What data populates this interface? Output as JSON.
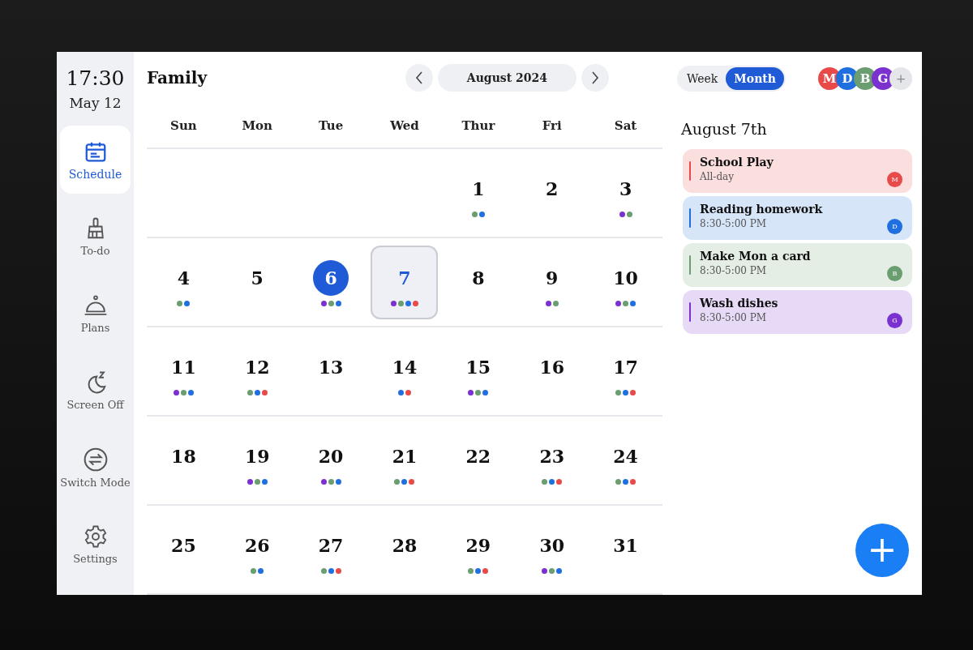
{
  "clock": {
    "time": "17:30",
    "date": "May 12"
  },
  "sidebar": {
    "items": [
      {
        "label": "Schedule",
        "selected": true
      },
      {
        "label": "To-do",
        "selected": false
      },
      {
        "label": "Plans",
        "selected": false
      },
      {
        "label": "Screen Off",
        "selected": false
      },
      {
        "label": "Switch Mode",
        "selected": false
      },
      {
        "label": "Settings",
        "selected": false
      }
    ]
  },
  "header": {
    "title": "Family",
    "month": "August 2024"
  },
  "view_toggle": [
    {
      "label": "Week",
      "selected": false
    },
    {
      "label": "Month",
      "selected": true
    }
  ],
  "members": [
    {
      "initial": "M",
      "color": "#e84a4a"
    },
    {
      "initial": "D",
      "color": "#1f6fe0"
    },
    {
      "initial": "B",
      "color": "#6a9e70"
    },
    {
      "initial": "G",
      "color": "#7b30d0"
    }
  ],
  "add_member": "+",
  "weekdays": [
    "Sun",
    "Mon",
    "Tue",
    "Wed",
    "Thur",
    "Fri",
    "Sat"
  ],
  "days": [
    {
      "kind": "blank"
    },
    {
      "kind": "blank"
    },
    {
      "kind": "blank"
    },
    {
      "kind": "blank"
    },
    {
      "kind": "day",
      "label": "1",
      "today": false,
      "selected": false,
      "dots": [
        {
          "color": "#6a9e70"
        },
        {
          "color": "#1f6fe0"
        }
      ]
    },
    {
      "kind": "day",
      "label": "2",
      "today": false,
      "selected": false
    },
    {
      "kind": "day",
      "label": "3",
      "today": false,
      "selected": false,
      "dots": [
        {
          "color": "#7b30d0"
        },
        {
          "color": "#6a9e70"
        }
      ]
    },
    {
      "kind": "day",
      "label": "4",
      "today": false,
      "selected": false,
      "dots": [
        {
          "color": "#6a9e70"
        },
        {
          "color": "#1f6fe0"
        }
      ]
    },
    {
      "kind": "day",
      "label": "5",
      "today": false,
      "selected": false
    },
    {
      "kind": "day",
      "label": "6",
      "today": true,
      "selected": false,
      "dots": [
        {
          "color": "#7b30d0"
        },
        {
          "color": "#6a9e70"
        },
        {
          "color": "#1f6fe0"
        }
      ]
    },
    {
      "kind": "day",
      "label": "7",
      "today": false,
      "selected": true,
      "dots": [
        {
          "color": "#7b30d0"
        },
        {
          "color": "#6a9e70"
        },
        {
          "color": "#1f6fe0"
        },
        {
          "color": "#e84a4a"
        }
      ]
    },
    {
      "kind": "day",
      "label": "8",
      "today": false,
      "selected": false
    },
    {
      "kind": "day",
      "label": "9",
      "today": false,
      "selected": false,
      "dots": [
        {
          "color": "#7b30d0"
        },
        {
          "color": "#6a9e70"
        }
      ]
    },
    {
      "kind": "day",
      "label": "10",
      "today": false,
      "selected": false,
      "dots": [
        {
          "color": "#7b30d0"
        },
        {
          "color": "#6a9e70"
        },
        {
          "color": "#1f6fe0"
        }
      ]
    },
    {
      "kind": "day",
      "label": "11",
      "today": false,
      "selected": false,
      "dots": [
        {
          "color": "#7b30d0"
        },
        {
          "color": "#6a9e70"
        },
        {
          "color": "#1f6fe0"
        }
      ]
    },
    {
      "kind": "day",
      "label": "12",
      "today": false,
      "selected": false,
      "dots": [
        {
          "color": "#6a9e70"
        },
        {
          "color": "#1f6fe0"
        },
        {
          "color": "#e84a4a"
        }
      ]
    },
    {
      "kind": "day",
      "label": "13",
      "today": false,
      "selected": false
    },
    {
      "kind": "day",
      "label": "14",
      "today": false,
      "selected": false,
      "dots": [
        {
          "color": "#1f6fe0"
        },
        {
          "color": "#e84a4a"
        }
      ]
    },
    {
      "kind": "day",
      "label": "15",
      "today": false,
      "selected": false,
      "dots": [
        {
          "color": "#7b30d0"
        },
        {
          "color": "#6a9e70"
        },
        {
          "color": "#1f6fe0"
        }
      ]
    },
    {
      "kind": "day",
      "label": "16",
      "today": false,
      "selected": false
    },
    {
      "kind": "day",
      "label": "17",
      "today": false,
      "selected": false,
      "dots": [
        {
          "color": "#6a9e70"
        },
        {
          "color": "#1f6fe0"
        },
        {
          "color": "#e84a4a"
        }
      ]
    },
    {
      "kind": "day",
      "label": "18",
      "today": false,
      "selected": false
    },
    {
      "kind": "day",
      "label": "19",
      "today": false,
      "selected": false,
      "dots": [
        {
          "color": "#7b30d0"
        },
        {
          "color": "#6a9e70"
        },
        {
          "color": "#1f6fe0"
        }
      ]
    },
    {
      "kind": "day",
      "label": "20",
      "today": false,
      "selected": false,
      "dots": [
        {
          "color": "#7b30d0"
        },
        {
          "color": "#6a9e70"
        },
        {
          "color": "#1f6fe0"
        }
      ]
    },
    {
      "kind": "day",
      "label": "21",
      "today": false,
      "selected": false,
      "dots": [
        {
          "color": "#6a9e70"
        },
        {
          "color": "#1f6fe0"
        },
        {
          "color": "#e84a4a"
        }
      ]
    },
    {
      "kind": "day",
      "label": "22",
      "today": false,
      "selected": false
    },
    {
      "kind": "day",
      "label": "23",
      "today": false,
      "selected": false,
      "dots": [
        {
          "color": "#6a9e70"
        },
        {
          "color": "#1f6fe0"
        },
        {
          "color": "#e84a4a"
        }
      ]
    },
    {
      "kind": "day",
      "label": "24",
      "today": false,
      "selected": false,
      "dots": [
        {
          "color": "#6a9e70"
        },
        {
          "color": "#1f6fe0"
        },
        {
          "color": "#e84a4a"
        }
      ]
    },
    {
      "kind": "day",
      "label": "25",
      "today": false,
      "selected": false
    },
    {
      "kind": "day",
      "label": "26",
      "today": false,
      "selected": false,
      "dots": [
        {
          "color": "#6a9e70"
        },
        {
          "color": "#1f6fe0"
        }
      ]
    },
    {
      "kind": "day",
      "label": "27",
      "today": false,
      "selected": false,
      "dots": [
        {
          "color": "#6a9e70"
        },
        {
          "color": "#1f6fe0"
        },
        {
          "color": "#e84a4a"
        }
      ]
    },
    {
      "kind": "day",
      "label": "28",
      "today": false,
      "selected": false
    },
    {
      "kind": "day",
      "label": "29",
      "today": false,
      "selected": false,
      "dots": [
        {
          "color": "#6a9e70"
        },
        {
          "color": "#1f6fe0"
        },
        {
          "color": "#e84a4a"
        }
      ]
    },
    {
      "kind": "day",
      "label": "30",
      "today": false,
      "selected": false,
      "dots": [
        {
          "color": "#7b30d0"
        },
        {
          "color": "#6a9e70"
        },
        {
          "color": "#1f6fe0"
        }
      ]
    },
    {
      "kind": "day",
      "label": "31",
      "today": false,
      "selected": false
    }
  ],
  "agenda": {
    "date": "August 7th",
    "events": [
      {
        "title": "School Play",
        "time": "All-day",
        "initial": "M",
        "color": "#e84a4a"
      },
      {
        "title": "Reading homework",
        "time": "8:30-5:00 PM",
        "initial": "D",
        "color": "#1f6fe0"
      },
      {
        "title": "Make Mon a card",
        "time": "8:30-5:00 PM",
        "initial": "B",
        "color": "#6a9e70"
      },
      {
        "title": "Wash dishes",
        "time": "8:30-5:00 PM",
        "initial": "G",
        "color": "#7b30d0"
      }
    ]
  },
  "add_button": "+"
}
